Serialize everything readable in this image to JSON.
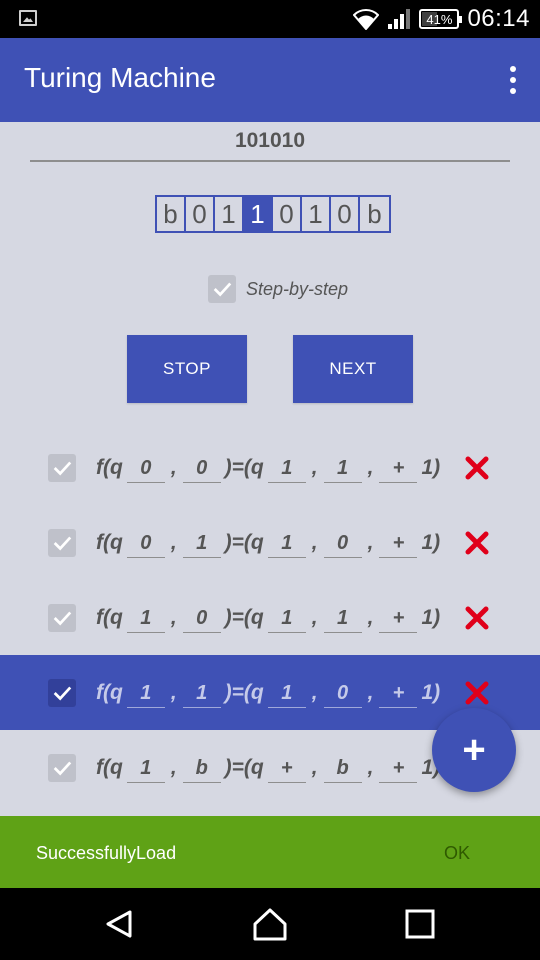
{
  "status_bar": {
    "time": "06:14",
    "battery": "41%",
    "battery_level": 0.41,
    "icons": [
      "image-icon",
      "wifi-icon",
      "signal-icon",
      "battery-icon"
    ]
  },
  "app_bar": {
    "title": "Turing Machine",
    "menu_icon": "overflow-menu-icon"
  },
  "input": {
    "value": "101010"
  },
  "tape": {
    "cells": [
      "b",
      "0",
      "1",
      "1",
      "0",
      "1",
      "0",
      "b"
    ],
    "head_index": 3
  },
  "step_by_step": {
    "label": "Step-by-step",
    "checked": true
  },
  "buttons": {
    "stop": "STOP",
    "next": "NEXT"
  },
  "rule_text": {
    "prefix": "f(q",
    "comma": ",",
    "mid": ")=(q",
    "suffix": ")"
  },
  "rules": [
    {
      "state": "0",
      "read": "0",
      "new_state": "1",
      "write": "1",
      "move": "+",
      "tail": "1",
      "checked": true,
      "selected": false
    },
    {
      "state": "0",
      "read": "1",
      "new_state": "1",
      "write": "0",
      "move": "+",
      "tail": "1",
      "checked": true,
      "selected": false
    },
    {
      "state": "1",
      "read": "0",
      "new_state": "1",
      "write": "1",
      "move": "+",
      "tail": "1",
      "checked": true,
      "selected": false
    },
    {
      "state": "1",
      "read": "1",
      "new_state": "1",
      "write": "0",
      "move": "+",
      "tail": "1",
      "checked": true,
      "selected": true
    },
    {
      "state": "1",
      "read": "b",
      "new_state": "+",
      "write": "b",
      "move": "+",
      "tail": "1",
      "checked": true,
      "selected": false
    }
  ],
  "fab": {
    "icon": "plus-icon",
    "label": "+"
  },
  "snackbar": {
    "message": "SuccessfullyLoad",
    "action": "OK"
  },
  "colors": {
    "primary": "#3f51b5",
    "background": "#d6d8e2",
    "snackbar": "#5fa216",
    "delete": "#e0001a"
  }
}
